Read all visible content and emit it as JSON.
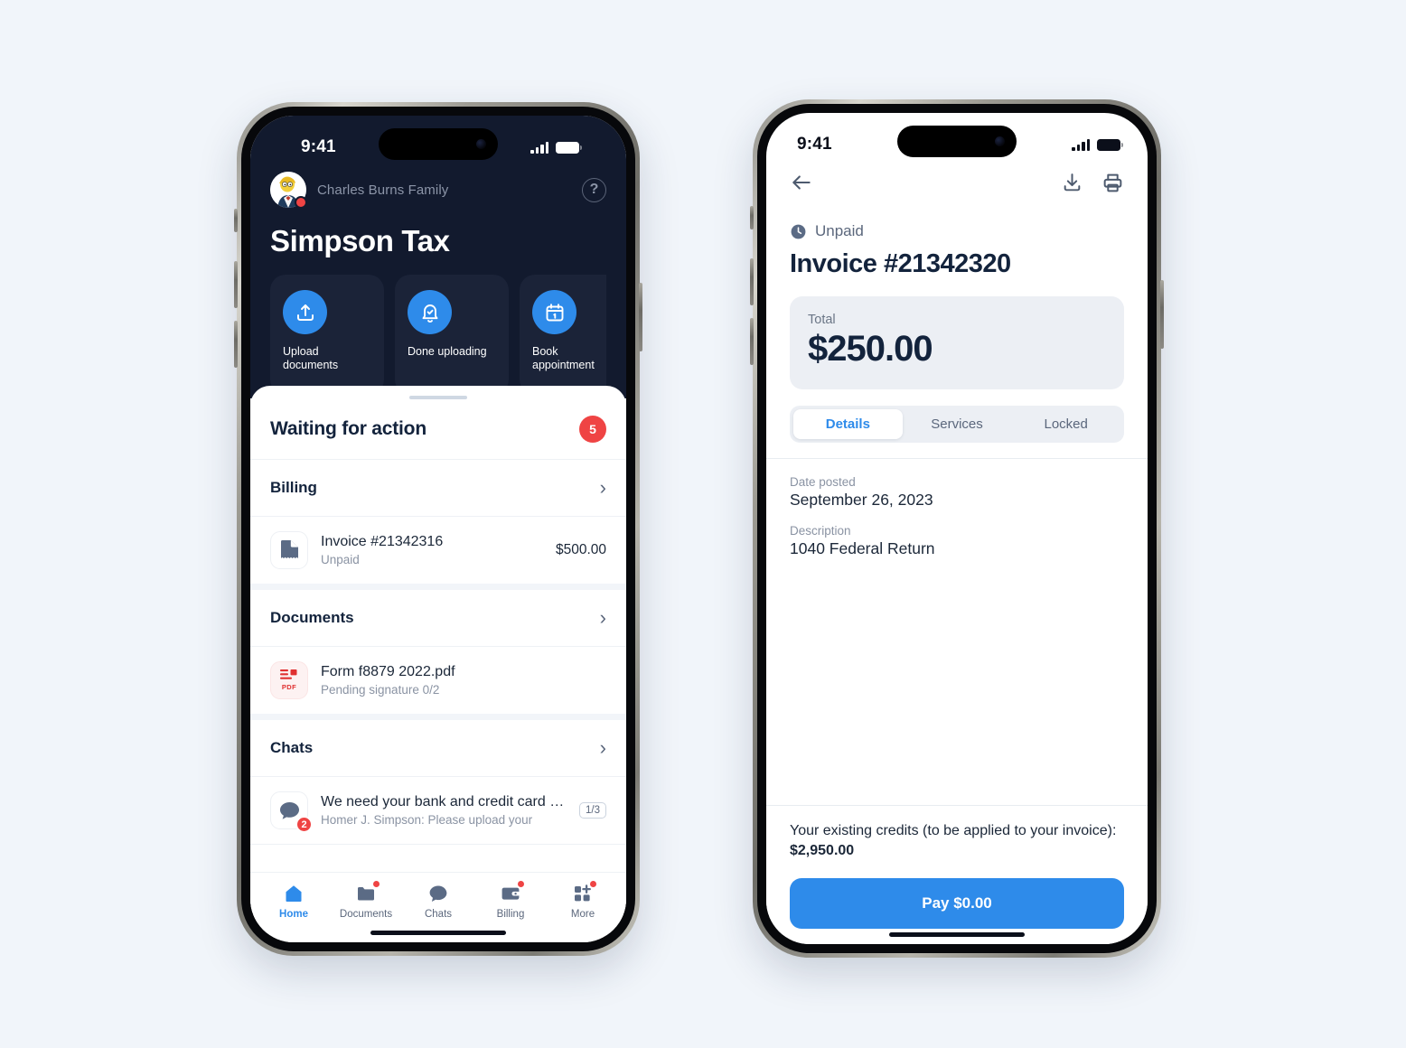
{
  "page": {
    "background": "#f1f5fa",
    "accent": "#2e8bea",
    "danger": "#ef4444",
    "dark_header": "#121a2e"
  },
  "phone1": {
    "status": {
      "time": "9:41",
      "signal_icon": "cellular-bars-icon",
      "battery_icon": "battery-icon"
    },
    "header": {
      "avatar_icon": "user-avatar",
      "family_name": "Charles Burns Family",
      "help_icon": "help-circle-icon",
      "help_glyph": "?",
      "brand_title": "Simpson Tax"
    },
    "quick_actions": [
      {
        "icon": "upload-icon",
        "label": "Upload documents"
      },
      {
        "icon": "bell-check-icon",
        "label": "Done uploading"
      },
      {
        "icon": "calendar-icon",
        "label": "Book appointment"
      }
    ],
    "sheet": {
      "title": "Waiting for action",
      "count": "5",
      "groups": [
        {
          "name": "Billing",
          "chevron": "chevron-right-icon",
          "items": [
            {
              "icon": "invoice-document-icon",
              "title": "Invoice #21342316",
              "subtitle": "Unpaid",
              "amount": "$500.00"
            }
          ]
        },
        {
          "name": "Documents",
          "chevron": "chevron-right-icon",
          "items": [
            {
              "icon": "pdf-file-icon",
              "icon_tag": "PDF",
              "title": "Form f8879 2022.pdf",
              "subtitle": "Pending signature 0/2",
              "amount": ""
            }
          ]
        },
        {
          "name": "Chats",
          "chevron": "chevron-right-icon",
          "items": [
            {
              "icon": "chat-bubble-icon",
              "badge": "2",
              "title": "We need your bank and credit card s…",
              "subtitle": "Homer J. Simpson: Please upload your",
              "pill": "1/3"
            }
          ]
        }
      ]
    },
    "tabbar": [
      {
        "icon": "home-icon",
        "label": "Home",
        "active": true,
        "dot": false
      },
      {
        "icon": "folder-icon",
        "label": "Documents",
        "active": false,
        "dot": true
      },
      {
        "icon": "chat-icon",
        "label": "Chats",
        "active": false,
        "dot": false
      },
      {
        "icon": "wallet-icon",
        "label": "Billing",
        "active": false,
        "dot": true
      },
      {
        "icon": "grid-plus-icon",
        "label": "More",
        "active": false,
        "dot": true
      }
    ]
  },
  "phone2": {
    "status": {
      "time": "9:41",
      "signal_icon": "cellular-bars-icon",
      "battery_icon": "battery-icon"
    },
    "topbar": {
      "back_icon": "arrow-left-icon",
      "download_icon": "download-icon",
      "print_icon": "print-icon"
    },
    "status_row": {
      "icon": "clock-icon",
      "text": "Unpaid"
    },
    "invoice_title": "Invoice #21342320",
    "total": {
      "label": "Total",
      "amount": "$250.00"
    },
    "tabs": [
      {
        "label": "Details",
        "active": true
      },
      {
        "label": "Services",
        "active": false
      },
      {
        "label": "Locked",
        "active": false
      }
    ],
    "details": [
      {
        "label": "Date posted",
        "value": "September 26, 2023"
      },
      {
        "label": "Description",
        "value": "1040 Federal Return"
      }
    ],
    "footer": {
      "credits_text": "Your existing credits (to be applied to your invoice): ",
      "credits_amount": "$2,950.00",
      "pay_label": "Pay $0.00"
    }
  }
}
